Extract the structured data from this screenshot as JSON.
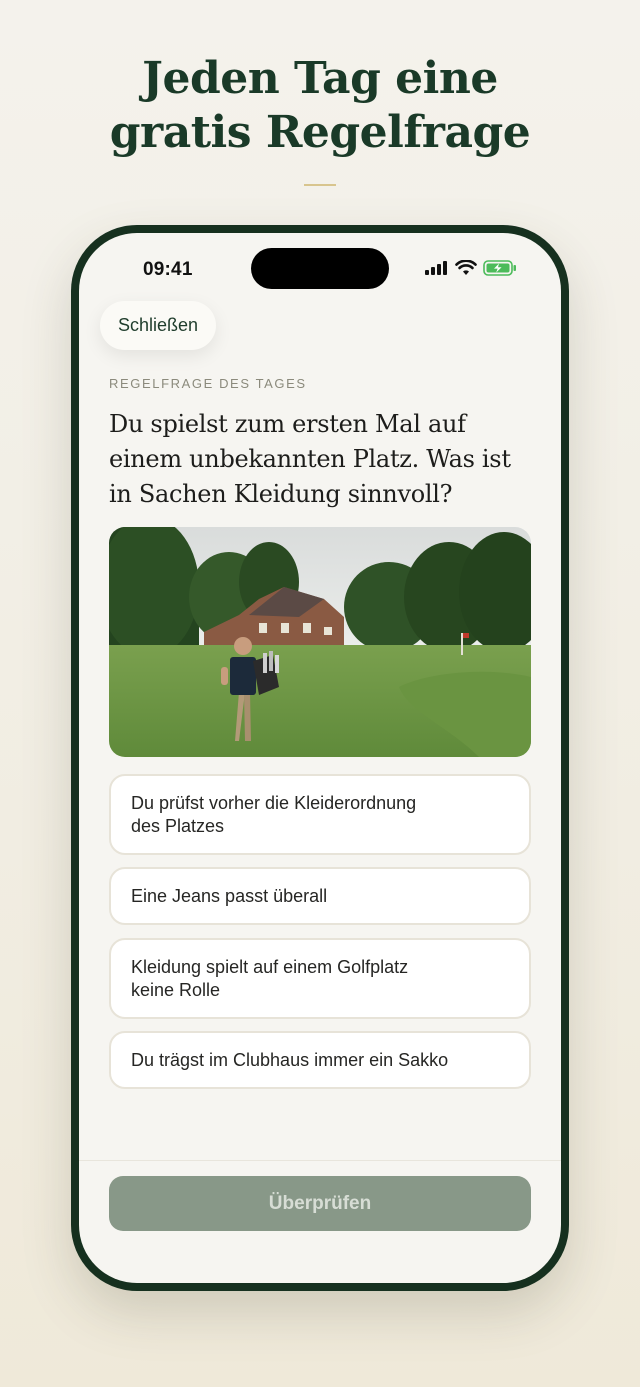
{
  "promo": {
    "headline_line1": "Jeden Tag eine",
    "headline_line2": "gratis Regelfrage"
  },
  "status_bar": {
    "time": "09:41"
  },
  "quiz": {
    "close_label": "Schließen",
    "eyebrow": "REGELFRAGE DES TAGES",
    "question": "Du spielst zum ersten Mal auf einem unbekannten Platz. Was ist in Sachen Kleidung sinnvoll?",
    "answers": [
      {
        "line1": "Du prüfst vorher die Kleiderordnung",
        "line2": "des Platzes"
      },
      {
        "line1": "Eine Jeans passt überall",
        "line2": ""
      },
      {
        "line1": "Kleidung spielt auf einem Golfplatz",
        "line2": "keine Rolle"
      },
      {
        "line1": "Du trägst im Clubhaus immer ein Sakko",
        "line2": ""
      }
    ],
    "submit_label": "Überprüfen"
  },
  "colors": {
    "brand_green": "#1a3a28",
    "phone_frame": "#16301f",
    "accent_gold": "#d8c58e",
    "button_disabled": "#889888",
    "screen_bg": "#f6f5f1"
  },
  "icons": [
    "signal-icon",
    "wifi-icon",
    "battery-charging-icon"
  ]
}
